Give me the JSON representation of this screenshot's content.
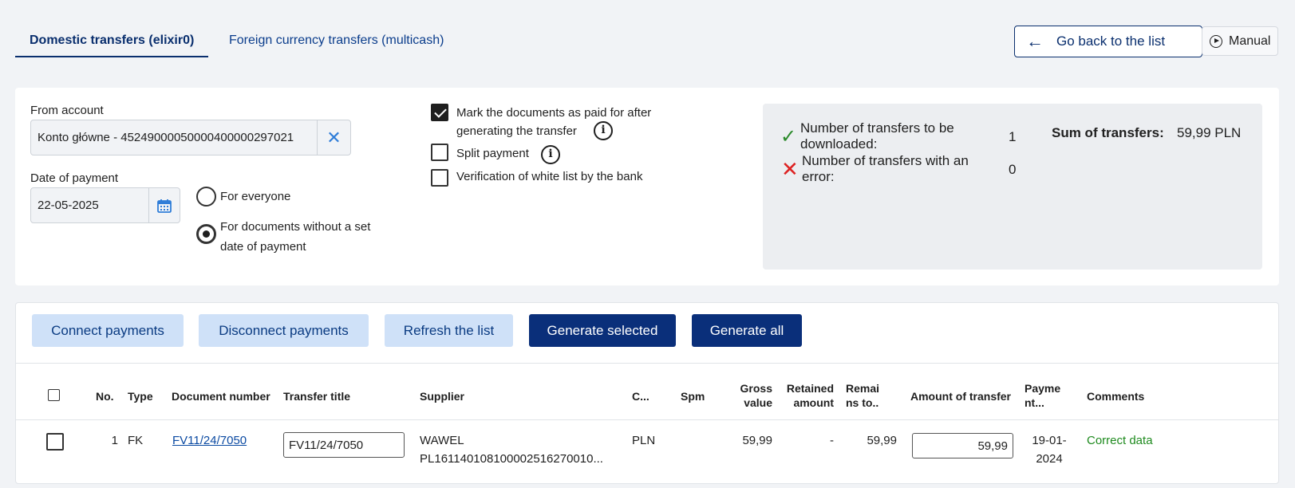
{
  "tabs": [
    {
      "label": "Domestic transfers (elixir0)",
      "active": true
    },
    {
      "label": "Foreign currency transfers (multicash)",
      "active": false
    }
  ],
  "header": {
    "back_label": "Go back to the list",
    "manual_label": "Manual"
  },
  "form": {
    "from_account_label": "From account",
    "from_account_value": "Konto główne - 45249000050000400000297021",
    "date_label": "Date of payment",
    "date_value": "22-05-2025",
    "radio_everyone": "For everyone",
    "radio_no_date_line1": "For documents without a set",
    "radio_no_date_line2": "date of payment",
    "radio_selected": "no_date",
    "cb_mark_paid_line1": "Mark the documents as paid for after",
    "cb_mark_paid_line2": "generating the transfer",
    "cb_mark_paid_checked": true,
    "cb_split": "Split payment",
    "cb_split_checked": false,
    "cb_whitelist": "Verification of white list by the bank",
    "cb_whitelist_checked": false
  },
  "summary": {
    "to_download_line1": "Number of transfers to be",
    "to_download_line2": "downloaded:",
    "to_download_count": "1",
    "error_line1": "Number of transfers with an",
    "error_line2": "error:",
    "error_count": "0",
    "sum_label": "Sum of transfers:",
    "sum_value": "59,99 PLN"
  },
  "actions": {
    "connect": "Connect payments",
    "disconnect": "Disconnect payments",
    "refresh": "Refresh the list",
    "generate_selected": "Generate selected",
    "generate_all": "Generate all"
  },
  "table": {
    "headers": {
      "no": "No.",
      "type": "Type",
      "doc": "Document number",
      "title": "Transfer title",
      "supplier": "Supplier",
      "currency": "C...",
      "spm": "Spm",
      "gross_1": "Gross",
      "gross_2": "value",
      "retained_1": "Retained",
      "retained_2": "amount",
      "remains_1": "Remai",
      "remains_2": "ns to..",
      "amount": "Amount of transfer",
      "payment_1": "Payme",
      "payment_2": "nt...",
      "comments": "Comments"
    },
    "rows": [
      {
        "no": "1",
        "type": "FK",
        "doc": "FV11/24/7050",
        "title": "FV11/24/7050",
        "supplier_1": "WAWEL",
        "supplier_2": "PL161140108100002516270010...",
        "currency": "PLN",
        "gross": "59,99",
        "retained": "-",
        "remains": "59,99",
        "amount": "59,99",
        "payment_1": "19-01-",
        "payment_2": "2024",
        "comments": "Correct data",
        "selected": false
      }
    ]
  }
}
